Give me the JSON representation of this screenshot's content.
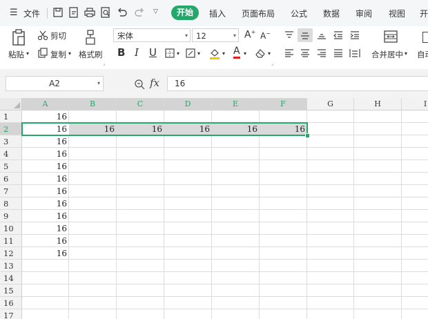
{
  "menu": {
    "file_label": "文件",
    "tabs": [
      "开始",
      "插入",
      "页面布局",
      "公式",
      "数据",
      "审阅",
      "视图",
      "开"
    ]
  },
  "ribbon": {
    "paste": "粘贴",
    "cut": "剪切",
    "copy": "复制",
    "format_painter": "格式刷",
    "font_name": "宋体",
    "font_size": "12",
    "bold": "B",
    "italic": "I",
    "underline": "U",
    "merge_center": "合并居中",
    "auto": "自动"
  },
  "formula_bar": {
    "name_box": "A2",
    "fx_label": "fx",
    "value": "16"
  },
  "sheet": {
    "columns": [
      "A",
      "B",
      "C",
      "D",
      "E",
      "F",
      "G",
      "H",
      "I"
    ],
    "rows": [
      "1",
      "2",
      "3",
      "4",
      "5",
      "6",
      "7",
      "8",
      "9",
      "10",
      "11",
      "12",
      "13",
      "14",
      "15",
      "16",
      "17"
    ],
    "col_a_values": [
      "16",
      "16",
      "16",
      "16",
      "16",
      "16",
      "16",
      "16",
      "16",
      "16",
      "16",
      "16"
    ],
    "row2_values": [
      "16",
      "16",
      "16",
      "16",
      "16",
      "16"
    ]
  },
  "colors": {
    "accent": "#22a86b",
    "selection_fill": "#d9d9d9"
  }
}
